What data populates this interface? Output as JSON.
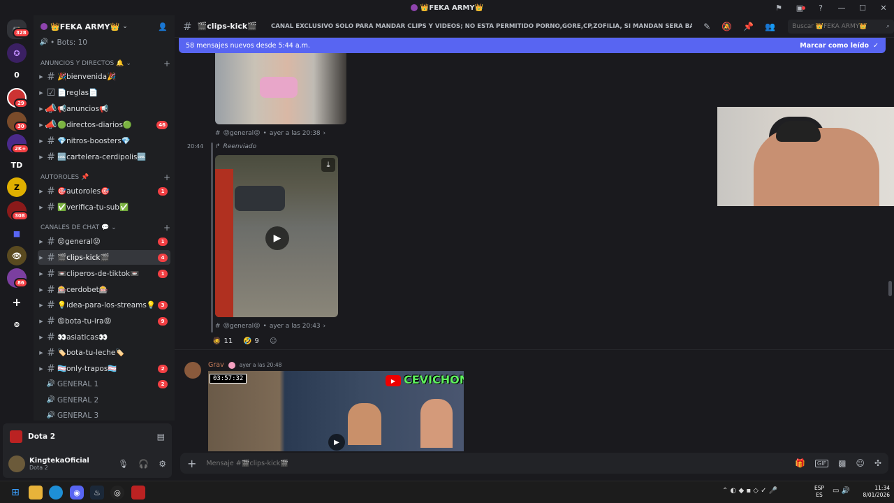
{
  "window": {
    "title": "👑FEKA ARMY👑"
  },
  "server_rail": {
    "badges": [
      "328",
      "29",
      "30",
      "2K+",
      "308",
      "86"
    ],
    "labels": [
      "0",
      "TD"
    ]
  },
  "guild": {
    "name": "👑FEKA ARMY👑",
    "top_item": "• Bots: 10"
  },
  "categories": {
    "anuncios": "ANUNCIOS Y DIRECTOS 🔔",
    "autoroles": "AUTOROLES 📌",
    "chat": "CANALES DE CHAT 💬"
  },
  "channels": [
    {
      "name": "🎉bienvenida🎉",
      "count": ""
    },
    {
      "name": "📄reglas📄",
      "count": ""
    },
    {
      "name": "📢anuncios📢",
      "count": ""
    },
    {
      "name": "🟢directos-diarios🟢",
      "count": "46"
    },
    {
      "name": "💎nitros-boosters💎",
      "count": ""
    },
    {
      "name": "🆒cartelera-cerdipolis🆒",
      "count": ""
    },
    {
      "name": "🎯autoroles🎯",
      "count": "1"
    },
    {
      "name": "✅verifica-tu-sub✅",
      "count": ""
    },
    {
      "name": "😝general😝",
      "count": "1"
    },
    {
      "name": "🎬clips-kick🎬",
      "count": "4"
    },
    {
      "name": "📼cliperos-de-tiktok📼",
      "count": "1"
    },
    {
      "name": "🎰cerdobet🎰",
      "count": ""
    },
    {
      "name": "💡idea-para-los-streams💡",
      "count": "3"
    },
    {
      "name": "😡bota-tu-ira😡",
      "count": "9"
    },
    {
      "name": "👀asiaticas👀",
      "count": ""
    },
    {
      "name": "🏷️bota-tu-leche🏷️",
      "count": ""
    },
    {
      "name": "🏳️‍⚧️only-trapos🏳️‍⚧️",
      "count": "2"
    },
    {
      "name": "GENERAL 1",
      "count": "2"
    },
    {
      "name": "GENERAL 2",
      "count": ""
    },
    {
      "name": "GENERAL 3",
      "count": ""
    }
  ],
  "activity": {
    "game": "Dota 2"
  },
  "user": {
    "name": "KingtekaOficial",
    "status": "Dota 2"
  },
  "channel_header": {
    "name": "🎬clips-kick🎬",
    "topic": "CANAL EXCLUSIVO SOLO PARA MANDAR CLIPS Y VIDEOS; NO ESTA PERMITIDO PORNO,GORE,CP,ZOFILIA, SI MANDAN SERA BANEADO PERMA...",
    "search_placeholder": "Buscar 👑FEKA ARMY👑"
  },
  "banner": {
    "text": "58 mensajes nuevos desde 5:44 a.m.",
    "action": "Marcar como leído"
  },
  "messages": {
    "first_source": "😝general😝",
    "first_time": "ayer a las 20:38",
    "second_timestamp": "20:44",
    "forwarded_label": "Reenviado",
    "second_source": "😝general😝",
    "second_time": "ayer a las 20:43",
    "reactions": [
      {
        "emoji": "🧔",
        "count": "11"
      },
      {
        "emoji": "🤣",
        "count": "9"
      }
    ],
    "third_author": "Grav",
    "third_time": "ayer a las 20:48",
    "video_duration": "03:57:32",
    "thumbnail_text": "CEVICHON"
  },
  "composer": {
    "placeholder": "Mensaje #🎬clips-kick🎬"
  },
  "taskbar": {
    "lang": "ESP",
    "region": "ES",
    "time": "11:34",
    "date": "8/01/2026"
  },
  "colors": {
    "accent": "#5865f2",
    "mention": "#f23f43",
    "bg": "#1a1a1e"
  }
}
